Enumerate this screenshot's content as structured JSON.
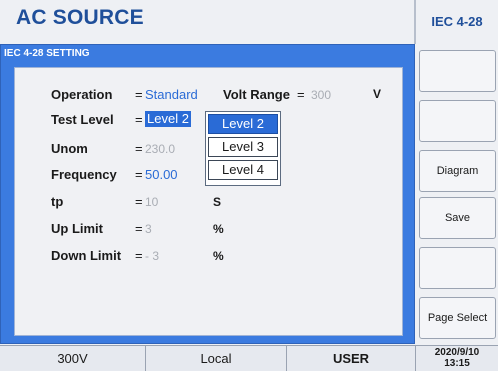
{
  "header": {
    "app_title": "AC SOURCE",
    "standard_tag": "IEC 4-28"
  },
  "panel": {
    "title": "IEC 4-28 SETTING",
    "operation": {
      "label": "Operation",
      "eq": "=",
      "value": "Standard"
    },
    "volt_range": {
      "label": "Volt Range",
      "eq": "=",
      "value": "300",
      "unit": "V"
    },
    "test_level": {
      "label": "Test Level",
      "eq": "=",
      "value": "Level 2"
    },
    "unom": {
      "label": "Unom",
      "eq": "=",
      "value": "230.0"
    },
    "frequency": {
      "label": "Frequency",
      "eq": "=",
      "value": "50.00"
    },
    "tp": {
      "label": "tp",
      "eq": "=",
      "value": "10",
      "unit": "S"
    },
    "up_limit": {
      "label": "Up Limit",
      "eq": "=",
      "value": "3",
      "unit": "%"
    },
    "down_limit": {
      "label": "Down Limit",
      "eq": "=",
      "value": "- 3",
      "unit": "%"
    },
    "dropdown_options": [
      "Level 2",
      "Level 3",
      "Level 4"
    ]
  },
  "softkeys": [
    "",
    "",
    "Diagram",
    "Save",
    "",
    "Page Select"
  ],
  "statusbar": {
    "range": "300V",
    "mode": "Local",
    "user": "USER",
    "date": "2020/9/10",
    "time": "13:15"
  },
  "colors": {
    "accent": "#2a6bd6",
    "title_blue": "#1f4f9a",
    "panel_blue": "#3b7be0",
    "disabled_grey": "#a9adb4"
  }
}
